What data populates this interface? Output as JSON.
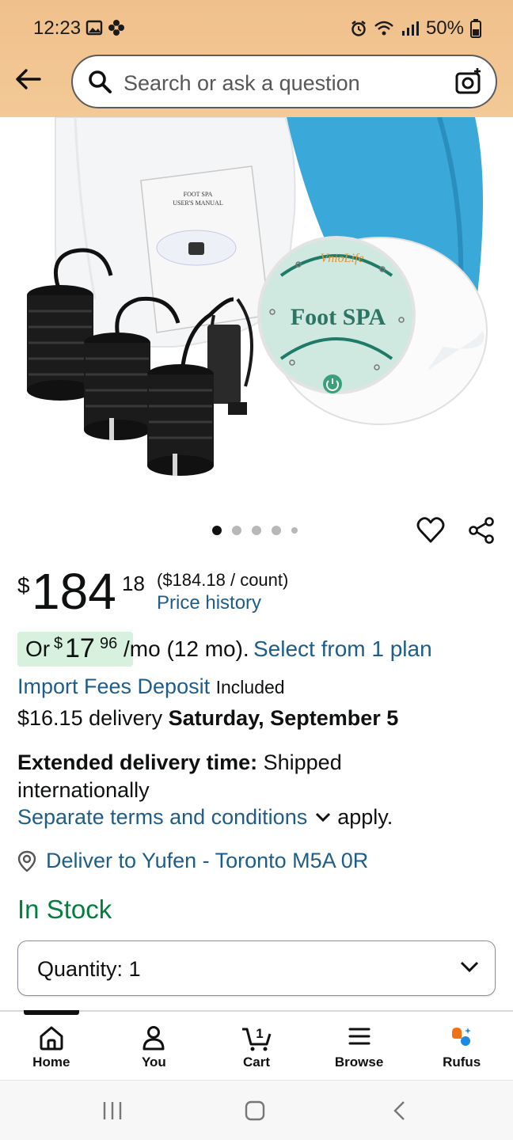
{
  "status": {
    "time": "12:23",
    "battery": "50%"
  },
  "search": {
    "placeholder": "Search or ask a question"
  },
  "product": {
    "manual_title": "FOOT SPA",
    "manual_subtitle": "USER'S MANUAL",
    "brand": "VnioLife",
    "device_label": "Foot SPA"
  },
  "gallery": {
    "image_count": 5,
    "active_index": 0
  },
  "price": {
    "currency": "$",
    "whole": "184",
    "fraction": "18",
    "unit_price": "($184.18 / count)",
    "history_link": "Price history"
  },
  "plan": {
    "prefix": "Or",
    "currency": "$",
    "whole": "17",
    "fraction": "96",
    "term": "/mo (12 mo).",
    "select_link": "Select from 1 plan"
  },
  "fees": {
    "link": "Import Fees Deposit",
    "status": "Included"
  },
  "delivery": {
    "cost": "$16.15 delivery",
    "date": "Saturday, September 5"
  },
  "extended": {
    "label": "Extended delivery time:",
    "text": "Shipped internationally",
    "terms_link": "Separate terms and conditions",
    "terms_suffix": "apply."
  },
  "deliver_to": "Deliver to Yufen - Toronto M5A 0R",
  "stock": "In Stock",
  "quantity": {
    "label": "Quantity:",
    "value": "1"
  },
  "nav": {
    "items": [
      {
        "label": "Home"
      },
      {
        "label": "You"
      },
      {
        "label": "Cart",
        "badge": "1"
      },
      {
        "label": "Browse"
      },
      {
        "label": "Rufus"
      }
    ]
  },
  "colors": {
    "header": "#f3c996",
    "link": "#1f5d89",
    "stock": "#067d3e",
    "pill": "#d7f1de"
  }
}
